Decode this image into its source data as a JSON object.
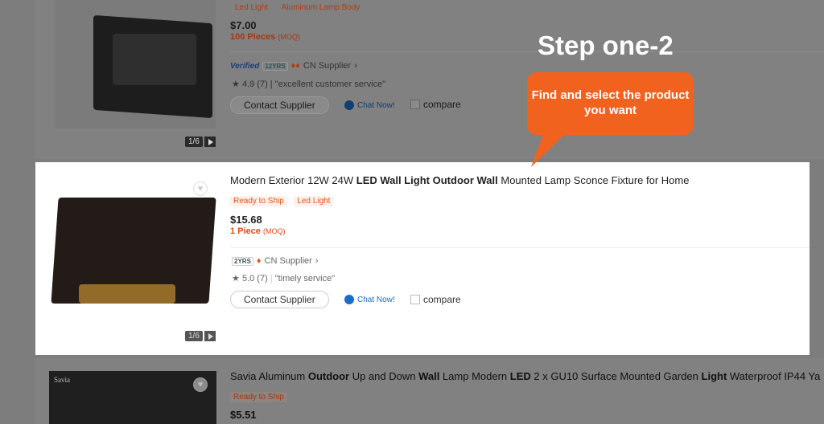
{
  "top_card": {
    "tags": [
      "Led Light",
      "Aluminum Lamp Body"
    ],
    "price": "$7.00",
    "moq": "100 Pieces",
    "moq_suffix": "(MOQ)",
    "verified": "Verified",
    "years": "12",
    "years_suffix": "YRS",
    "supplier": "CN Supplier",
    "rating": "4.9 (7)",
    "review": "\"excellent customer service\"",
    "contact": "Contact Supplier",
    "chat": "Chat Now!",
    "compare": "compare",
    "pager": "1/6"
  },
  "focus_card": {
    "title_parts": [
      {
        "text": "Modern Exterior 12W 24W ",
        "bold": false
      },
      {
        "text": "LED Wall Light Outdoor Wall",
        "bold": true
      },
      {
        "text": " Mounted Lamp Sconce Fixture for Home",
        "bold": false
      }
    ],
    "tags": [
      "Ready to Ship",
      "Led Light"
    ],
    "price": "$15.68",
    "moq": "1 Piece",
    "moq_suffix": "(MOQ)",
    "years": "2",
    "years_suffix": "YRS",
    "supplier": "CN Supplier",
    "rating": "5.0 (7)",
    "review": "\"timely service\"",
    "contact": "Contact Supplier",
    "chat": "Chat Now!",
    "compare": "compare",
    "pager": "1/6"
  },
  "bottom_card": {
    "title_parts": [
      {
        "text": "Savia Aluminum ",
        "bold": false
      },
      {
        "text": "Outdoor",
        "bold": true
      },
      {
        "text": " Up and Down ",
        "bold": false
      },
      {
        "text": "Wall",
        "bold": true
      },
      {
        "text": " Lamp Modern ",
        "bold": false
      },
      {
        "text": "LED",
        "bold": true
      },
      {
        "text": " 2 x GU10 Surface Mounted Garden ",
        "bold": false
      },
      {
        "text": "Light",
        "bold": true
      },
      {
        "text": " Waterproof IP44 Ya",
        "bold": false
      }
    ],
    "tag": "Ready to Ship",
    "price": "$5.51",
    "thumb_text": "Savia"
  },
  "annotation": {
    "step": "Step one-2",
    "bubble": "Find and select the product you want"
  },
  "colors": {
    "accent": "#f2621f",
    "moq": "#e04a16",
    "chat": "#1a6ec9"
  }
}
